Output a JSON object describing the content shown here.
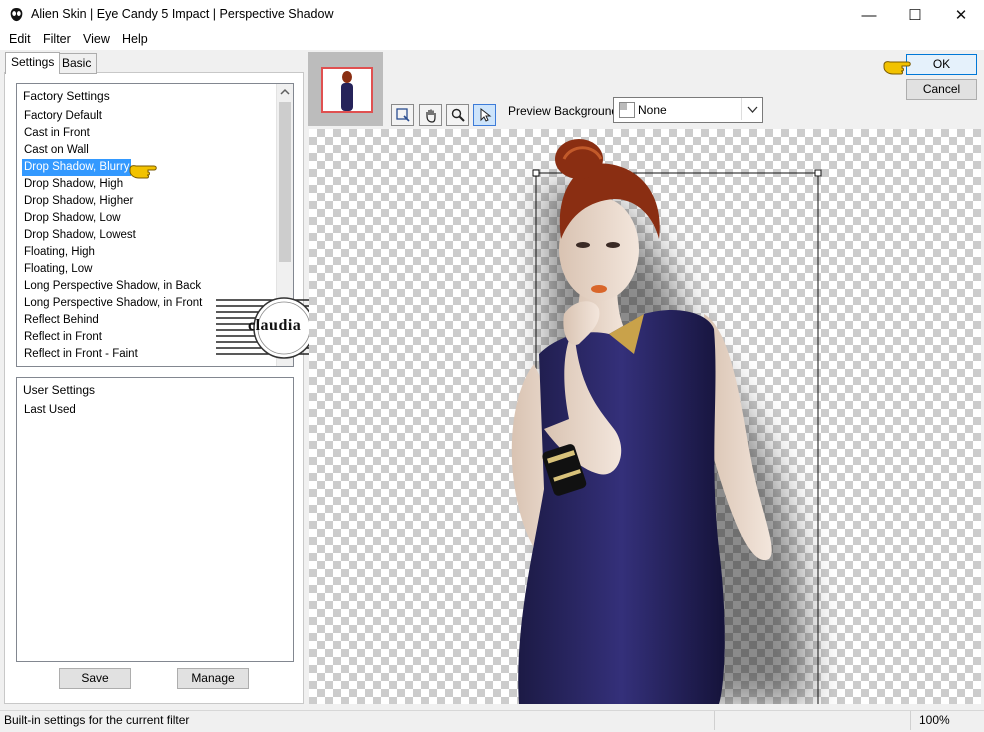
{
  "window": {
    "title": "Alien Skin | Eye Candy 5 Impact | Perspective Shadow",
    "minimize_glyph": "—",
    "maximize_glyph": "☐",
    "close_glyph": "✕"
  },
  "menu": [
    "Edit",
    "Filter",
    "View",
    "Help"
  ],
  "tabs": [
    {
      "label": "Settings",
      "active": true
    },
    {
      "label": "Basic",
      "active": false
    }
  ],
  "factory_settings": {
    "header": "Factory Settings",
    "items": [
      "Factory Default",
      "Cast in Front",
      "Cast on Wall",
      "Drop Shadow, Blurry",
      "Drop Shadow, High",
      "Drop Shadow, Higher",
      "Drop Shadow, Low",
      "Drop Shadow, Lowest",
      "Floating, High",
      "Floating, Low",
      "Long Perspective Shadow, in Back",
      "Long Perspective Shadow, in Front",
      "Reflect Behind",
      "Reflect in Front",
      "Reflect in Front - Faint"
    ],
    "selected_index": 3
  },
  "user_settings": {
    "header": "User Settings",
    "items": [
      "Last Used"
    ]
  },
  "buttons": {
    "save": "Save",
    "manage": "Manage",
    "ok": "OK",
    "cancel": "Cancel"
  },
  "preview": {
    "background_label": "Preview Background:",
    "background_value": "None",
    "tools": [
      "navigate-icon",
      "hand-icon",
      "zoom-icon",
      "arrow-icon"
    ]
  },
  "watermark": {
    "text": "claudia"
  },
  "status": {
    "text": "Built-in settings for the current filter",
    "zoom": "100%"
  },
  "colors": {
    "selection": "#3399ff",
    "dress": "#26235a",
    "hair": "#8a2e12",
    "pointer": "#f2c200"
  }
}
